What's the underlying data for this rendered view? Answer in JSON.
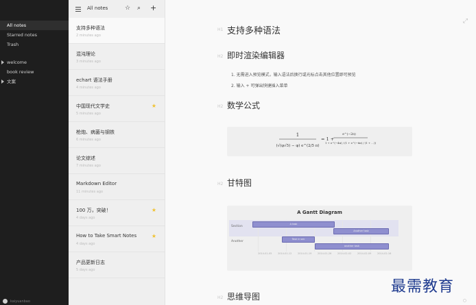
{
  "sidebar": {
    "nav": [
      "All notes",
      "Starred notes",
      "Trash"
    ],
    "notebooks": [
      "welcome",
      "book review",
      "文案"
    ],
    "user": "kaiyuanbao"
  },
  "list": {
    "title": "All notes",
    "notes": [
      {
        "title": "支持多种语法",
        "sub": "2 minutes ago",
        "starred": false,
        "active": true
      },
      {
        "title": "混沌理论",
        "sub": "3 minutes ago",
        "starred": false
      },
      {
        "title": "echart 语法手册",
        "sub": "4 minutes ago",
        "starred": false
      },
      {
        "title": "中国现代文学史",
        "sub": "5 minutes ago",
        "starred": true
      },
      {
        "title": "枪炮、病菌与钢铁",
        "sub": "6 minutes ago",
        "starred": false
      },
      {
        "title": "论文综述",
        "sub": "7 minutes ago",
        "starred": false
      },
      {
        "title": "Markdown Editor",
        "sub": "11 minutes ago",
        "starred": false
      },
      {
        "title": "100 万，突破！",
        "sub": "4 days ago",
        "starred": true
      },
      {
        "title": "How to Take Smart Notes",
        "sub": "4 days ago",
        "starred": true
      },
      {
        "title": "产品更新日志",
        "sub": "5 days ago",
        "starred": false
      }
    ]
  },
  "editor": {
    "h1": "支持多种语法",
    "sections": [
      {
        "heading": "即时渲染编辑器",
        "mark": "H2"
      },
      {
        "heading": "数学公式",
        "mark": "H2"
      },
      {
        "heading": "甘特图",
        "mark": "H2"
      },
      {
        "heading": "思维导图",
        "mark": "H2"
      }
    ],
    "h1_mark": "H1",
    "list_items": [
      "1. 无需进入预览模式，输入语法后换行或光标点击其他位置即可预览",
      "2. 输入 + 可弹出快捷插入菜单"
    ],
    "math": {
      "left_num": "1",
      "left_den": "(√(φ√5) − φ) e^(2/5 π)",
      "equals": "= 1 +",
      "right_num": "e^(−2π)",
      "right_den": "1 + e^(−4π) / (1 + e^(−6π) / (1 + …))"
    },
    "gantt": {
      "title": "A Gantt Diagram",
      "sections": [
        "Section",
        "Another"
      ],
      "tasks": [
        "A task",
        "Another task",
        "Task in sec",
        "another task"
      ],
      "ticks": [
        "2014-01-05",
        "2014-01-12",
        "2014-01-19",
        "2014-01-26",
        "2014-02-02",
        "2014-02-09",
        "2014-02-16"
      ]
    },
    "watermark": "最需教育"
  }
}
